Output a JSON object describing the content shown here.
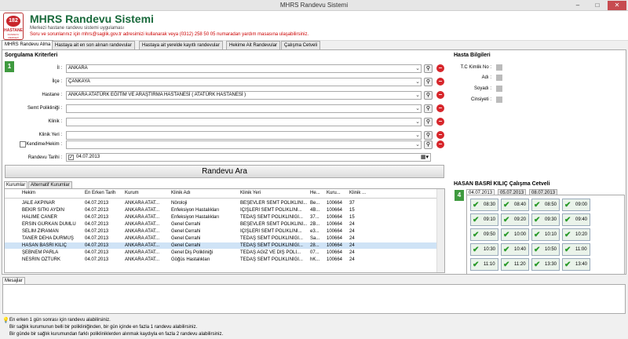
{
  "window": {
    "title": "MHRS Randevu Sistemi",
    "min": "–",
    "max": "□",
    "close": "✕"
  },
  "header": {
    "logo_num": "182",
    "logo_l1": "HASTANE",
    "logo_l2": "RANDEVU MERKEZİ",
    "title": "MHRS Randevu Sistemi",
    "subtitle": "Merkezi hastane randevu sistemi uygulaması",
    "info": "Soru ve sorunlarınız için mhrs@saglik.gov.tr adresimizi kullanarak veya (0312) 258 50 05 numaradan yardım masasına ulaşabilirsiniz."
  },
  "tabs": [
    "MHRS Randevu Alma",
    "Hastaya ait en son alınan randevular",
    "Hastaya ait yerelde kayıtlı randevular",
    "Hekime Ait Randevular",
    "Çalışma Cetveli"
  ],
  "query": {
    "title": "Sorgulama Kriterleri",
    "badge": "1",
    "fields": [
      {
        "label": "İl :",
        "value": "ANKARA"
      },
      {
        "label": "İlçe :",
        "value": "ÇANKAYA"
      },
      {
        "label": "Hastane :",
        "value": "ANKARA ATATÜRK EĞİTİM VE ARAŞTIRMA HASTANESİ ( ATATÜRK HASTANESİ )"
      },
      {
        "label": "Semt Polikliniği :",
        "value": ""
      },
      {
        "label": "Klinik :",
        "value": ""
      },
      {
        "label": "Klinik Yeri :",
        "value": ""
      },
      {
        "label": "Kendime/Hekim :",
        "value": ""
      }
    ],
    "date_label": "Randevu Tarihi :",
    "date_value": "04.07.2013",
    "search_label": "Randevu Ara"
  },
  "patient": {
    "title": "Hasta Bilgileri",
    "labels": [
      "T.C Kimlik No :",
      "Adı :",
      "Soyadı :",
      "Cinsiyeti :"
    ]
  },
  "results": {
    "tabs": [
      "Kurumlar",
      "Alternatif Kurumlar"
    ],
    "badge": "2",
    "columns": [
      "Hekim",
      "En Erken Tarih",
      "Kurum",
      "Klinik Adı",
      "Klinik Yeri",
      "He...",
      "Kuru...",
      "Klinik ..."
    ],
    "rows": [
      [
        "JALE AKPINAR",
        "04.07.2013",
        "ANKARA ATAT...",
        "Nöroloji",
        "BEŞEVLER SEMT POLİKLİNİ...",
        "Be...",
        "100664",
        "37"
      ],
      [
        "BEKİR SITKI AYDIN",
        "04.07.2013",
        "ANKARA ATAT...",
        "Enfeksiyon Hastalıkları",
        "İÇİŞLERİ SEMT POLİKLİNİ...",
        "4B...",
        "100664",
        "15"
      ],
      [
        "HALİME CANER",
        "04.07.2013",
        "ANKARA ATAT...",
        "Enfeksiyon Hastalıkları",
        "TEDAŞ SEMT POLİKLİNİĞİ...",
        "37...",
        "100664",
        "15"
      ],
      [
        "ERSİN GÜRKAN DUMLU",
        "04.07.2013",
        "ANKARA ATAT...",
        "Genel Cerrahi",
        "BEŞEVLER SEMT POLİKLİNİ...",
        "2B...",
        "100664",
        "24"
      ],
      [
        "SELİM ZİRAMAN",
        "04.07.2013",
        "ANKARA ATAT...",
        "Genel Cerrahi",
        "İÇİŞLERİ SEMT POLİKLİNİ...",
        "e3...",
        "100664",
        "24"
      ],
      [
        "TANER DEHA DURMUŞ",
        "04.07.2013",
        "ANKARA ATAT...",
        "Genel Cerrahi",
        "TEDAŞ SEMT POLİKLİNİĞİ...",
        "Sa...",
        "100664",
        "24"
      ],
      [
        "HASAN BASRİ KILIÇ",
        "04.07.2013",
        "ANKARA ATAT...",
        "Genel Cerrahi",
        "TEDAŞ SEMT POLİKLİNİĞİ...",
        "28...",
        "100664",
        "24"
      ],
      [
        "ŞEBNEM PARLA",
        "04.07.2013",
        "ANKARA ATAT...",
        "Genel Diş Polikliniği",
        "TEDAŞ AĞIZ VE DİŞ POLİ...",
        "07...",
        "100664",
        "24"
      ],
      [
        "NESRİN ÖZTÜRK",
        "04.07.2013",
        "ANKARA ATAT...",
        "Göğüs Hastalıkları",
        "TEDAŞ SEMT POLİKLİNİĞİ...",
        "hK...",
        "100664",
        "24"
      ]
    ]
  },
  "calendar": {
    "title": "HASAN BASRİ KILIÇ Çalışma Cetveli",
    "badge": "4",
    "dates": [
      "04.07.2013",
      "05.07.2013",
      "08.07.2013"
    ],
    "slots": [
      "08:30",
      "08:40",
      "08:50",
      "09:00",
      "09:10",
      "09:20",
      "09:30",
      "09:40",
      "09:50",
      "10:00",
      "10:10",
      "10:20",
      "10:30",
      "10:40",
      "10:50",
      "11:00",
      "11:10",
      "11:20",
      "13:30",
      "13:40"
    ]
  },
  "messages": {
    "tab": "Mesajlar"
  },
  "footer": {
    "notes": [
      "En erken 1 gün sonrası için randevu alabilirsiniz.",
      "Bir sağlık kurumunun belli bir polikliniğinden, bir gün içinde en fazla 1 randevu alabilirsiniz.",
      "Bir günde bir sağlık kurumundan farklı polikliniklerden alınmak kaydıyla en fazla 2 randevu alabilirsiniz."
    ]
  }
}
